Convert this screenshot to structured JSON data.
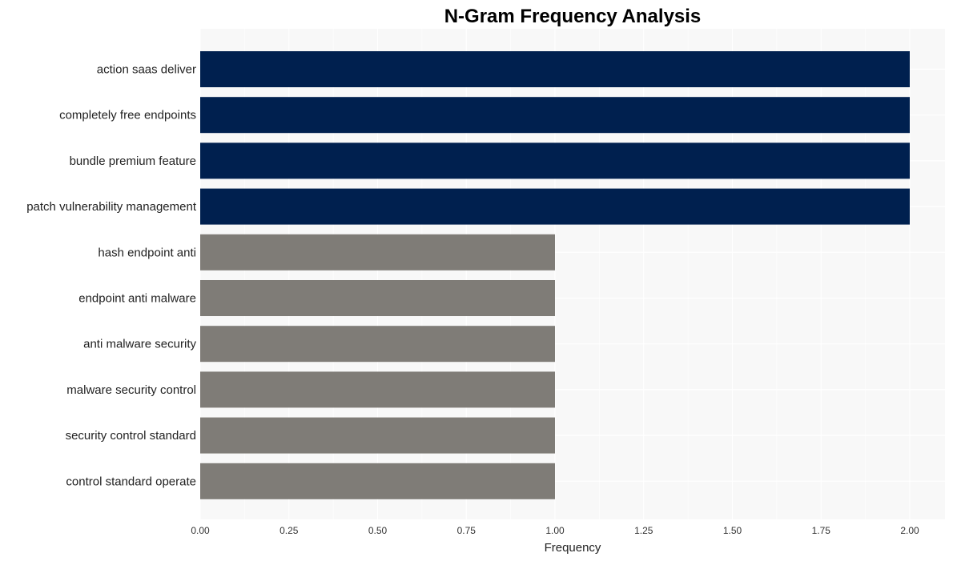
{
  "chart_data": {
    "type": "bar",
    "orientation": "horizontal",
    "title": "N-Gram Frequency Analysis",
    "xlabel": "Frequency",
    "ylabel": "",
    "xlim": [
      0,
      2.0
    ],
    "xticks": [
      0,
      0.25,
      0.5,
      0.75,
      1.0,
      1.25,
      1.5,
      1.75,
      2.0
    ],
    "xtick_labels": [
      "0.00",
      "0.25",
      "0.50",
      "0.75",
      "1.00",
      "1.25",
      "1.50",
      "1.75",
      "2.00"
    ],
    "grid": true,
    "categories": [
      "action saas deliver",
      "completely free endpoints",
      "bundle premium feature",
      "patch vulnerability management",
      "hash endpoint anti",
      "endpoint anti malware",
      "anti malware security",
      "malware security control",
      "security control standard",
      "control standard operate"
    ],
    "values": [
      2,
      2,
      2,
      2,
      1,
      1,
      1,
      1,
      1,
      1
    ],
    "colors": {
      "high": "#00204f",
      "low": "#7f7c77",
      "plot_background": "#f8f8f8",
      "grid": "#ffffff"
    }
  }
}
